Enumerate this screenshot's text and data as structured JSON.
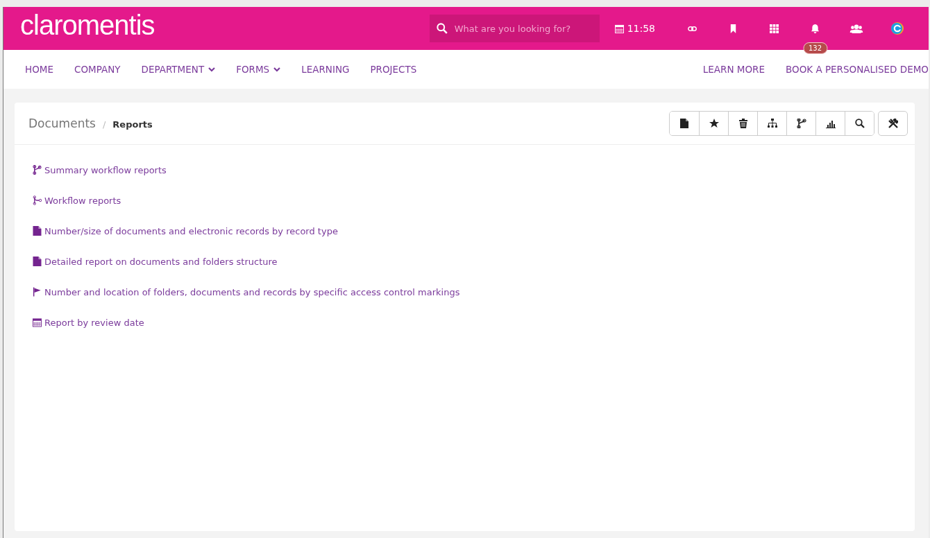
{
  "header": {
    "logo": "claromentis",
    "search": {
      "placeholder": "What are you looking for?"
    },
    "time": "11:58",
    "notification_count": "132"
  },
  "nav": {
    "left": [
      {
        "label": "HOME",
        "dropdown": false
      },
      {
        "label": "COMPANY",
        "dropdown": false
      },
      {
        "label": "DEPARTMENT",
        "dropdown": true
      },
      {
        "label": "FORMS",
        "dropdown": true
      },
      {
        "label": "LEARNING",
        "dropdown": false
      },
      {
        "label": "PROJECTS",
        "dropdown": false
      }
    ],
    "right": [
      "LEARN MORE",
      "BOOK A PERSONALISED DEMO"
    ]
  },
  "breadcrumb": {
    "parent": "Documents",
    "separator": "/",
    "current": "Reports"
  },
  "toolbar": [
    {
      "kind": "document"
    },
    {
      "kind": "star"
    },
    {
      "kind": "trash"
    },
    {
      "kind": "sitemap"
    },
    {
      "kind": "branch"
    },
    {
      "kind": "chart"
    },
    {
      "kind": "search"
    }
  ],
  "reports": [
    {
      "kind": "branch",
      "label": "Summary workflow reports"
    },
    {
      "kind": "workflow",
      "label": "Workflow reports"
    },
    {
      "kind": "document",
      "label": "Number/size of documents and electronic records by record type"
    },
    {
      "kind": "document",
      "label": "Detailed report on documents and folders structure"
    },
    {
      "kind": "flag",
      "label": "Number and location of folders, documents and records by specific access control markings"
    },
    {
      "kind": "calendar",
      "label": "Report by review date"
    }
  ]
}
